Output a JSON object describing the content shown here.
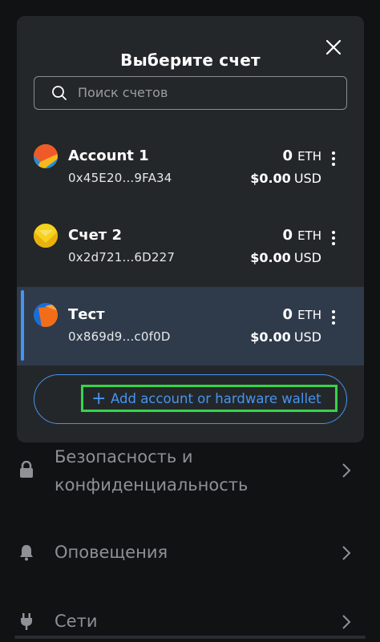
{
  "modal": {
    "title": "Выберите счет",
    "close_icon": "close-icon",
    "search": {
      "placeholder": "Поиск счетов",
      "value": ""
    },
    "accounts": [
      {
        "name": "Account 1",
        "address": "0x45E20...9FA34",
        "balance": "0",
        "currency": "ETH",
        "fiat": "$0.00",
        "fiat_currency": "USD",
        "selected": false,
        "avatar_colors": [
          "#f05a28",
          "#1f8fe0",
          "#f6b81e"
        ]
      },
      {
        "name": "Счет 2",
        "address": "0x2d721...6D227",
        "balance": "0",
        "currency": "ETH",
        "fiat": "$0.00",
        "fiat_currency": "USD",
        "selected": false,
        "avatar_colors": [
          "#f5d21c",
          "#e8b10f",
          "#f7e063"
        ]
      },
      {
        "name": "Тест",
        "address": "0x869d9...c0f0D",
        "balance": "0",
        "currency": "ETH",
        "fiat": "$0.00",
        "fiat_currency": "USD",
        "selected": true,
        "avatar_colors": [
          "#f26d1a",
          "#1b6dd6",
          "#f9a23a"
        ]
      }
    ],
    "add_button": {
      "icon": "plus-icon",
      "label": "Add account or hardware wallet"
    }
  },
  "background_settings": [
    {
      "icon": "lock-icon",
      "label_line1": "Безопасность и",
      "label_line2": "конфиденциальность"
    },
    {
      "icon": "bell-icon",
      "label": "Оповещения"
    },
    {
      "icon": "plug-icon",
      "label": "Сети"
    }
  ],
  "colors": {
    "accent": "#4594f0",
    "modal_bg": "#24272a",
    "selected_row": "#2f3b4b",
    "highlight": "#35d44a",
    "page_bg": "#111214"
  }
}
